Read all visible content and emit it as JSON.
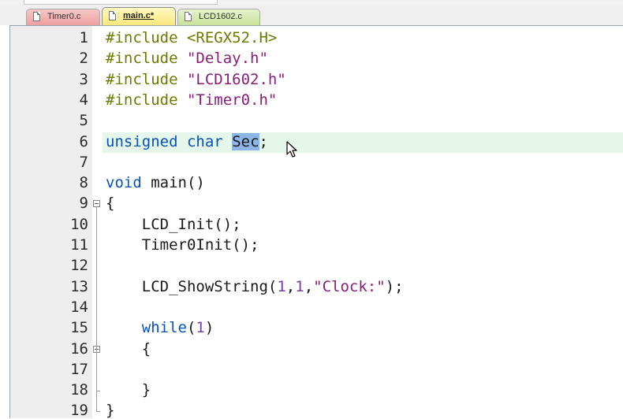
{
  "tabs": [
    {
      "label": "Timer0.c"
    },
    {
      "label": "main.c*"
    },
    {
      "label": "LCD1602.c"
    }
  ],
  "lines": [
    {
      "n": "1",
      "tokens": [
        {
          "t": "#include ",
          "c": "pp"
        },
        {
          "t": "<REGX52.H>",
          "c": "pp"
        }
      ]
    },
    {
      "n": "2",
      "tokens": [
        {
          "t": "#include ",
          "c": "pp"
        },
        {
          "t": "\"Delay.h\"",
          "c": "str"
        }
      ]
    },
    {
      "n": "3",
      "tokens": [
        {
          "t": "#include ",
          "c": "pp"
        },
        {
          "t": "\"LCD1602.h\"",
          "c": "str"
        }
      ]
    },
    {
      "n": "4",
      "tokens": [
        {
          "t": "#include ",
          "c": "pp"
        },
        {
          "t": "\"Timer0.h\"",
          "c": "str"
        }
      ]
    },
    {
      "n": "5",
      "tokens": []
    },
    {
      "n": "6",
      "tokens": [
        {
          "t": "unsigned",
          "c": "kw"
        },
        {
          "t": " ",
          "c": "plain"
        },
        {
          "t": "char",
          "c": "kw"
        },
        {
          "t": " ",
          "c": "plain"
        },
        {
          "t": "Sec",
          "c": "sel"
        },
        {
          "t": ";",
          "c": "plain"
        }
      ],
      "highlight": true
    },
    {
      "n": "7",
      "tokens": []
    },
    {
      "n": "8",
      "tokens": [
        {
          "t": "void",
          "c": "kw"
        },
        {
          "t": " main()",
          "c": "plain"
        }
      ]
    },
    {
      "n": "9",
      "tokens": [
        {
          "t": "{",
          "c": "plain"
        }
      ],
      "fold": "open"
    },
    {
      "n": "10",
      "tokens": [
        {
          "t": "    LCD_Init();",
          "c": "plain"
        }
      ]
    },
    {
      "n": "11",
      "tokens": [
        {
          "t": "    Timer0Init();",
          "c": "plain"
        }
      ]
    },
    {
      "n": "12",
      "tokens": []
    },
    {
      "n": "13",
      "tokens": [
        {
          "t": "    LCD_ShowString(",
          "c": "plain"
        },
        {
          "t": "1",
          "c": "num"
        },
        {
          "t": ",",
          "c": "plain"
        },
        {
          "t": "1",
          "c": "num"
        },
        {
          "t": ",",
          "c": "plain"
        },
        {
          "t": "\"Clock:\"",
          "c": "str"
        },
        {
          "t": ");",
          "c": "plain"
        }
      ]
    },
    {
      "n": "14",
      "tokens": []
    },
    {
      "n": "15",
      "tokens": [
        {
          "t": "    ",
          "c": "plain"
        },
        {
          "t": "while",
          "c": "kw"
        },
        {
          "t": "(",
          "c": "plain"
        },
        {
          "t": "1",
          "c": "num"
        },
        {
          "t": ")",
          "c": "plain"
        }
      ]
    },
    {
      "n": "16",
      "tokens": [
        {
          "t": "    {",
          "c": "plain"
        }
      ],
      "fold": "open"
    },
    {
      "n": "17",
      "tokens": []
    },
    {
      "n": "18",
      "tokens": [
        {
          "t": "    }",
          "c": "plain"
        }
      ],
      "fold": "end"
    },
    {
      "n": "19",
      "tokens": [
        {
          "t": "}",
          "c": "plain"
        }
      ],
      "fold": "end"
    }
  ]
}
